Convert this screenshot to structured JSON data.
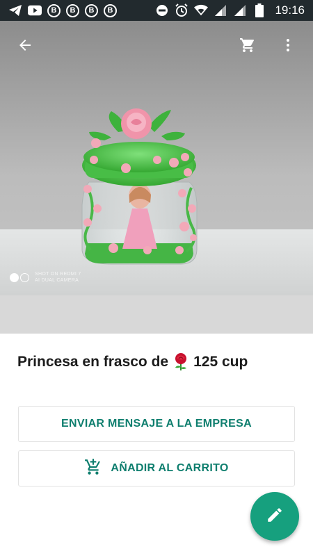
{
  "status_bar": {
    "time": "19:16",
    "notification_icons": [
      "telegram-icon",
      "youtube-icon",
      "b-badge-icon",
      "b-badge-icon",
      "b-badge-icon",
      "b-badge-icon"
    ],
    "b_badge_letter": "B",
    "system_icons": [
      "do-not-disturb-icon",
      "alarm-icon",
      "wifi-icon",
      "signal-icon",
      "signal-icon",
      "battery-icon"
    ]
  },
  "toolbar": {
    "back_icon": "arrow-back-icon",
    "cart_icon": "shopping-cart-icon",
    "menu_icon": "more-vert-icon"
  },
  "photo": {
    "watermark_line1": "SHOT ON REDMI 7",
    "watermark_line2": "AI DUAL CAMERA"
  },
  "product": {
    "title_before": "Princesa en frasco de",
    "title_after": "125 cup",
    "emoji_icon": "rose-icon"
  },
  "actions": {
    "message_label": "ENVIAR MENSAJE A LA EMPRESA",
    "add_cart_label": "AÑADIR AL CARRITO",
    "add_cart_icon": "add-shopping-cart-icon"
  },
  "fab": {
    "icon": "pencil-icon"
  },
  "colors": {
    "accent": "#0e7e6e",
    "fab": "#16a07e",
    "status_bar": "#222a2e",
    "jar_lid": "#4ec84a",
    "rose": "#f0a0b4"
  }
}
